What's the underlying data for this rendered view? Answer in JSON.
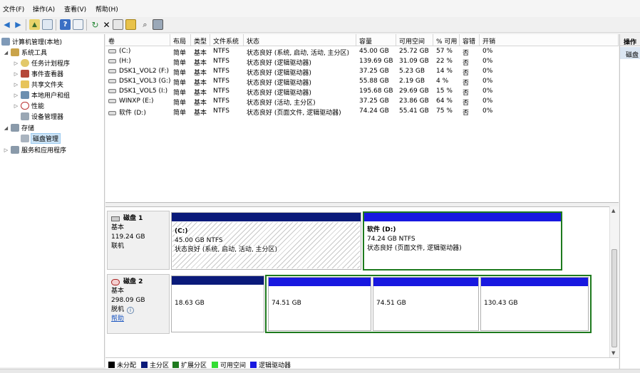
{
  "menu": [
    "文件(F)",
    "操作(A)",
    "查看(V)",
    "帮助(H)"
  ],
  "toolbar_icons": [
    "back-icon",
    "forward-icon",
    "up-icon",
    "show-hide-tree-icon",
    "help-icon",
    "properties-icon",
    "refresh-icon",
    "delete-icon",
    "properties2-icon",
    "open-icon",
    "search-icon",
    "disk-settings-icon"
  ],
  "tree": {
    "root": "计算机管理(本地)",
    "system_tools": "系统工具",
    "task_scheduler": "任务计划程序",
    "event_viewer": "事件查看器",
    "shared_folders": "共享文件夹",
    "local_users": "本地用户和组",
    "performance": "性能",
    "device_manager": "设备管理器",
    "storage": "存储",
    "disk_management": "磁盘管理",
    "services": "服务和应用程序"
  },
  "columns": [
    "卷",
    "布局",
    "类型",
    "文件系统",
    "状态",
    "容量",
    "可用空间",
    "% 可用",
    "容错",
    "开销"
  ],
  "volumes": [
    [
      "(C:)",
      "简单",
      "基本",
      "NTFS",
      "状态良好 (系统, 启动, 活动, 主分区)",
      "45.00 GB",
      "25.72 GB",
      "57 %",
      "否",
      "0%"
    ],
    [
      "(H:)",
      "简单",
      "基本",
      "NTFS",
      "状态良好 (逻辑驱动器)",
      "139.69 GB",
      "31.09 GB",
      "22 %",
      "否",
      "0%"
    ],
    [
      "DSK1_VOL2 (F:)",
      "简单",
      "基本",
      "NTFS",
      "状态良好 (逻辑驱动器)",
      "37.25 GB",
      "5.23 GB",
      "14 %",
      "否",
      "0%"
    ],
    [
      "DSK1_VOL3 (G:)",
      "简单",
      "基本",
      "NTFS",
      "状态良好 (逻辑驱动器)",
      "55.88 GB",
      "2.19 GB",
      "4 %",
      "否",
      "0%"
    ],
    [
      "DSK1_VOL5 (I:)",
      "简单",
      "基本",
      "NTFS",
      "状态良好 (逻辑驱动器)",
      "195.68 GB",
      "29.69 GB",
      "15 %",
      "否",
      "0%"
    ],
    [
      "WINXP (E:)",
      "简单",
      "基本",
      "NTFS",
      "状态良好 (活动, 主分区)",
      "37.25 GB",
      "23.86 GB",
      "64 %",
      "否",
      "0%"
    ],
    [
      "软件 (D:)",
      "简单",
      "基本",
      "NTFS",
      "状态良好 (页面文件, 逻辑驱动器)",
      "74.24 GB",
      "55.41 GB",
      "75 %",
      "否",
      "0%"
    ]
  ],
  "disk1": {
    "name": "磁盘 1",
    "type": "基本",
    "size": "119.24 GB",
    "state": "联机",
    "part_c": {
      "name": "(C:)",
      "size": "45.00 GB NTFS",
      "status": "状态良好 (系统, 启动, 活动, 主分区)"
    },
    "part_d": {
      "name": "软件  (D:)",
      "size": "74.24 GB NTFS",
      "status": "状态良好 (页面文件, 逻辑驱动器)"
    }
  },
  "disk2": {
    "name": "磁盘 2",
    "type": "基本",
    "size": "298.09 GB",
    "state": "脱机",
    "help": "帮助",
    "parts": [
      "18.63 GB",
      "74.51 GB",
      "74.51 GB",
      "130.43 GB"
    ]
  },
  "legend": [
    "未分配",
    "主分区",
    "扩展分区",
    "可用空间",
    "逻辑驱动器"
  ],
  "legend_colors": [
    "#000000",
    "#0a1a7a",
    "#1e7a1e",
    "#33dd33",
    "#1818e0"
  ],
  "actions": {
    "title": "操作",
    "item": "磁盘"
  }
}
